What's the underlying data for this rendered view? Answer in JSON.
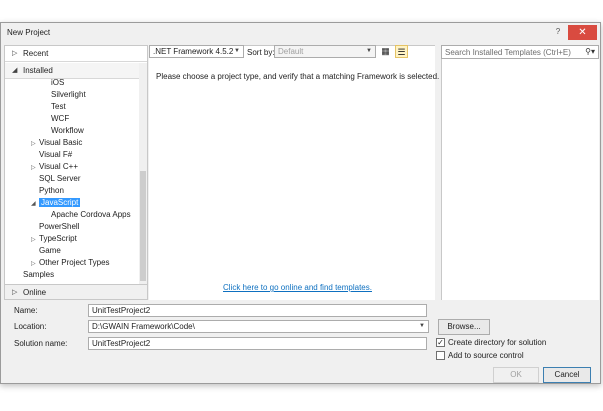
{
  "window": {
    "title": "New Project",
    "help": "?",
    "close": "✕"
  },
  "left_pane": {
    "sections": {
      "recent": "Recent",
      "installed": "Installed",
      "online": "Online"
    },
    "tree": [
      {
        "label": "iOS",
        "expander": ""
      },
      {
        "label": "Silverlight",
        "expander": ""
      },
      {
        "label": "Test",
        "expander": ""
      },
      {
        "label": "WCF",
        "expander": ""
      },
      {
        "label": "Workflow",
        "expander": ""
      },
      {
        "label": "Visual Basic",
        "expander": "▷"
      },
      {
        "label": "Visual F#",
        "expander": ""
      },
      {
        "label": "Visual C++",
        "expander": "▷"
      },
      {
        "label": "SQL Server",
        "expander": ""
      },
      {
        "label": "Python",
        "expander": ""
      },
      {
        "label": "JavaScript",
        "expander": "◢",
        "selected": true
      },
      {
        "label": "Apache Cordova Apps",
        "expander": ""
      },
      {
        "label": "PowerShell",
        "expander": ""
      },
      {
        "label": "TypeScript",
        "expander": "▷"
      },
      {
        "label": "Game",
        "expander": ""
      },
      {
        "label": "Other Project Types",
        "expander": "▷"
      },
      {
        "label": "Samples",
        "expander": ""
      }
    ]
  },
  "toolbar": {
    "framework": ".NET Framework 4.5.2",
    "sort_by_label": "Sort by:",
    "sort_by_value": "Default",
    "search_placeholder": "Search Installed Templates (Ctrl+E)"
  },
  "main": {
    "message": "Please choose a project type, and verify that a matching Framework is selected.",
    "online_link": "Click here to go online and find templates."
  },
  "form": {
    "name_label": "Name:",
    "name_value": "UnitTestProject2",
    "location_label": "Location:",
    "location_value": "D:\\GWAIN Framework\\Code\\",
    "solution_label": "Solution name:",
    "solution_value": "UnitTestProject2",
    "browse": "Browse...",
    "create_dir": "Create directory for solution",
    "create_dir_checked": true,
    "add_source_control": "Add to source control",
    "add_source_control_checked": false,
    "ok": "OK",
    "cancel": "Cancel"
  }
}
